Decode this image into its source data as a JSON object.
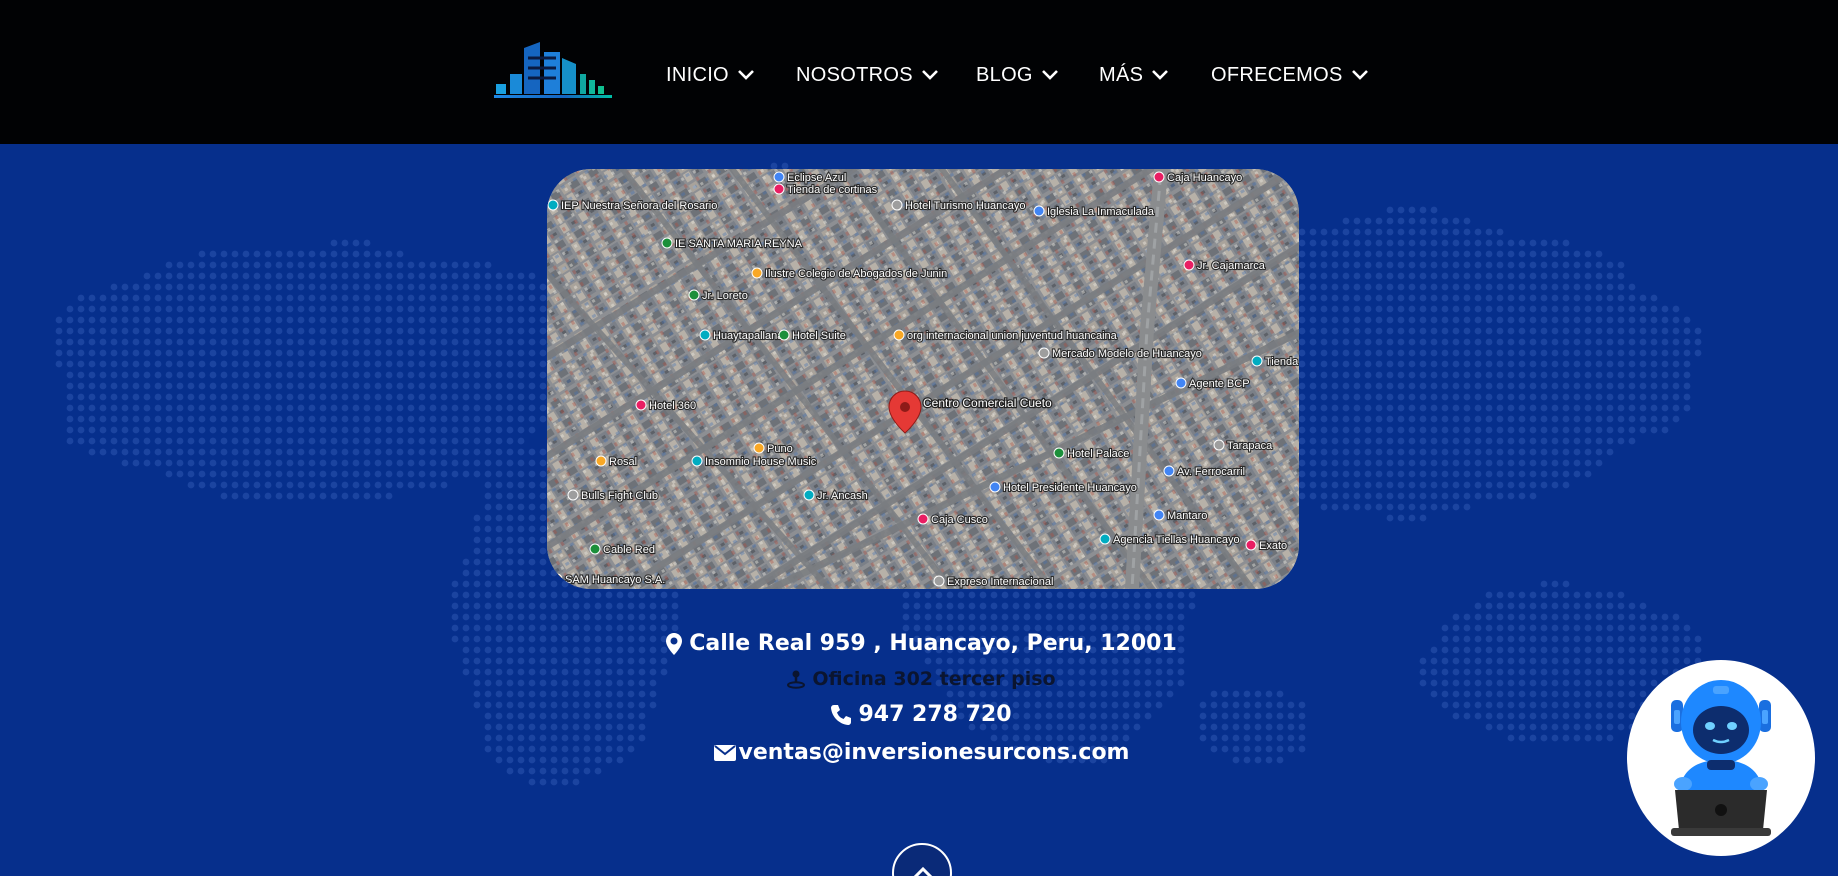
{
  "header": {
    "logo_icon": "building-logo-icon",
    "nav": [
      {
        "label": "INICIO"
      },
      {
        "label": "NOSOTROS"
      },
      {
        "label": "BLOG"
      },
      {
        "label": "MÁS"
      },
      {
        "label": "OFRECEMOS"
      }
    ]
  },
  "map": {
    "marker_label": "Centro Comercial Cueto",
    "places": [
      "Eclipse Azul",
      "Tienda de cortinas",
      "IEP Nuestra Señora del Rosario",
      "IE SANTA MARIA REYNA",
      "Ilustre Colegio de Abogados de Junin",
      "Hotel Turismo Huancayo",
      "Iglesia La Inmaculada",
      "Caja Huancayo",
      "Huaytapallana",
      "Hotel Suite",
      "org internacional union juventud huancaina",
      "Mercado Modelo de Huancayo",
      "Agente BCP",
      "Hotel 360",
      "Insomnio House Music",
      "Hotel Palace",
      "Rosal",
      "Bulls Fight Club",
      "Hotel Presidente Huancayo",
      "Caja Cusco",
      "Agencia Tiellas Huancayo",
      "Cable Red",
      "SAM Huancayo S.A.",
      "Expreso Internacional",
      "Av. Ferrocarril",
      "Jr. Cajamarca",
      "Jr. Ancash",
      "Jr. Loreto",
      "Puno",
      "Tarapaca",
      "Mantaro",
      "Exato",
      "Tienda"
    ]
  },
  "contact": {
    "address": "Calle Real 959 , Huancayo, Peru, 12001",
    "office": "Oficina 302 tercer piso",
    "phone": "947 278 720",
    "email": "ventas@inversionesurcons.com"
  },
  "colors": {
    "header_bg": "#010204",
    "page_bg": "#062f8c",
    "text": "#ffffff",
    "marker": "#e53935"
  }
}
